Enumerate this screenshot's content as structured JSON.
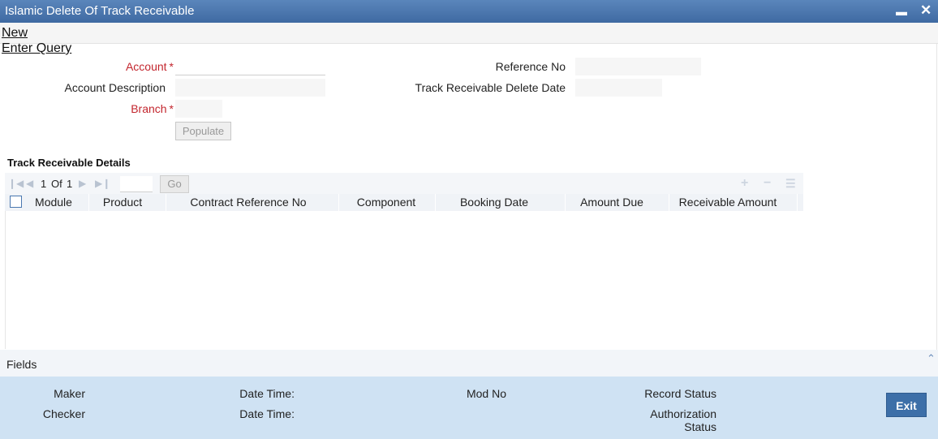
{
  "window": {
    "title": "Islamic Delete Of Track Receivable",
    "minimize_icon": "minimize-icon",
    "close_icon": "close-icon"
  },
  "menu": {
    "new_label": "New",
    "enter_query_label": "Enter Query"
  },
  "form": {
    "account_label": "Account",
    "account_value": "",
    "account_description_label": "Account Description",
    "account_description_value": "",
    "branch_label": "Branch",
    "branch_value": "",
    "required_marker": "*",
    "populate_label": "Populate",
    "reference_no_label": "Reference No",
    "reference_no_value": "",
    "delete_date_label": "Track Receivable Delete Date",
    "delete_date_value": ""
  },
  "details": {
    "section_title": "Track Receivable Details",
    "pager": {
      "current": "1",
      "of_label": "Of",
      "total": "1"
    },
    "page_input_value": "",
    "go_label": "Go",
    "icons": [
      "first-page-icon",
      "prev-page-icon",
      "next-page-icon",
      "last-page-icon",
      "add-row-icon",
      "delete-row-icon",
      "view-rows-icon"
    ],
    "columns": [
      "Module",
      "Product",
      "Contract Reference No",
      "Component",
      "Booking Date",
      "Amount Due",
      "Receivable Amount"
    ],
    "rows": []
  },
  "fields_bar": {
    "label": "Fields",
    "toggle_icon": "chevron-up-icon"
  },
  "audit": {
    "maker_label": "Maker",
    "checker_label": "Checker",
    "date_time_label": "Date Time:",
    "mod_no_label": "Mod No",
    "record_status_label": "Record Status",
    "authorization_label_line1": "Authorization",
    "authorization_label_line2": "Status",
    "exit_label": "Exit"
  }
}
